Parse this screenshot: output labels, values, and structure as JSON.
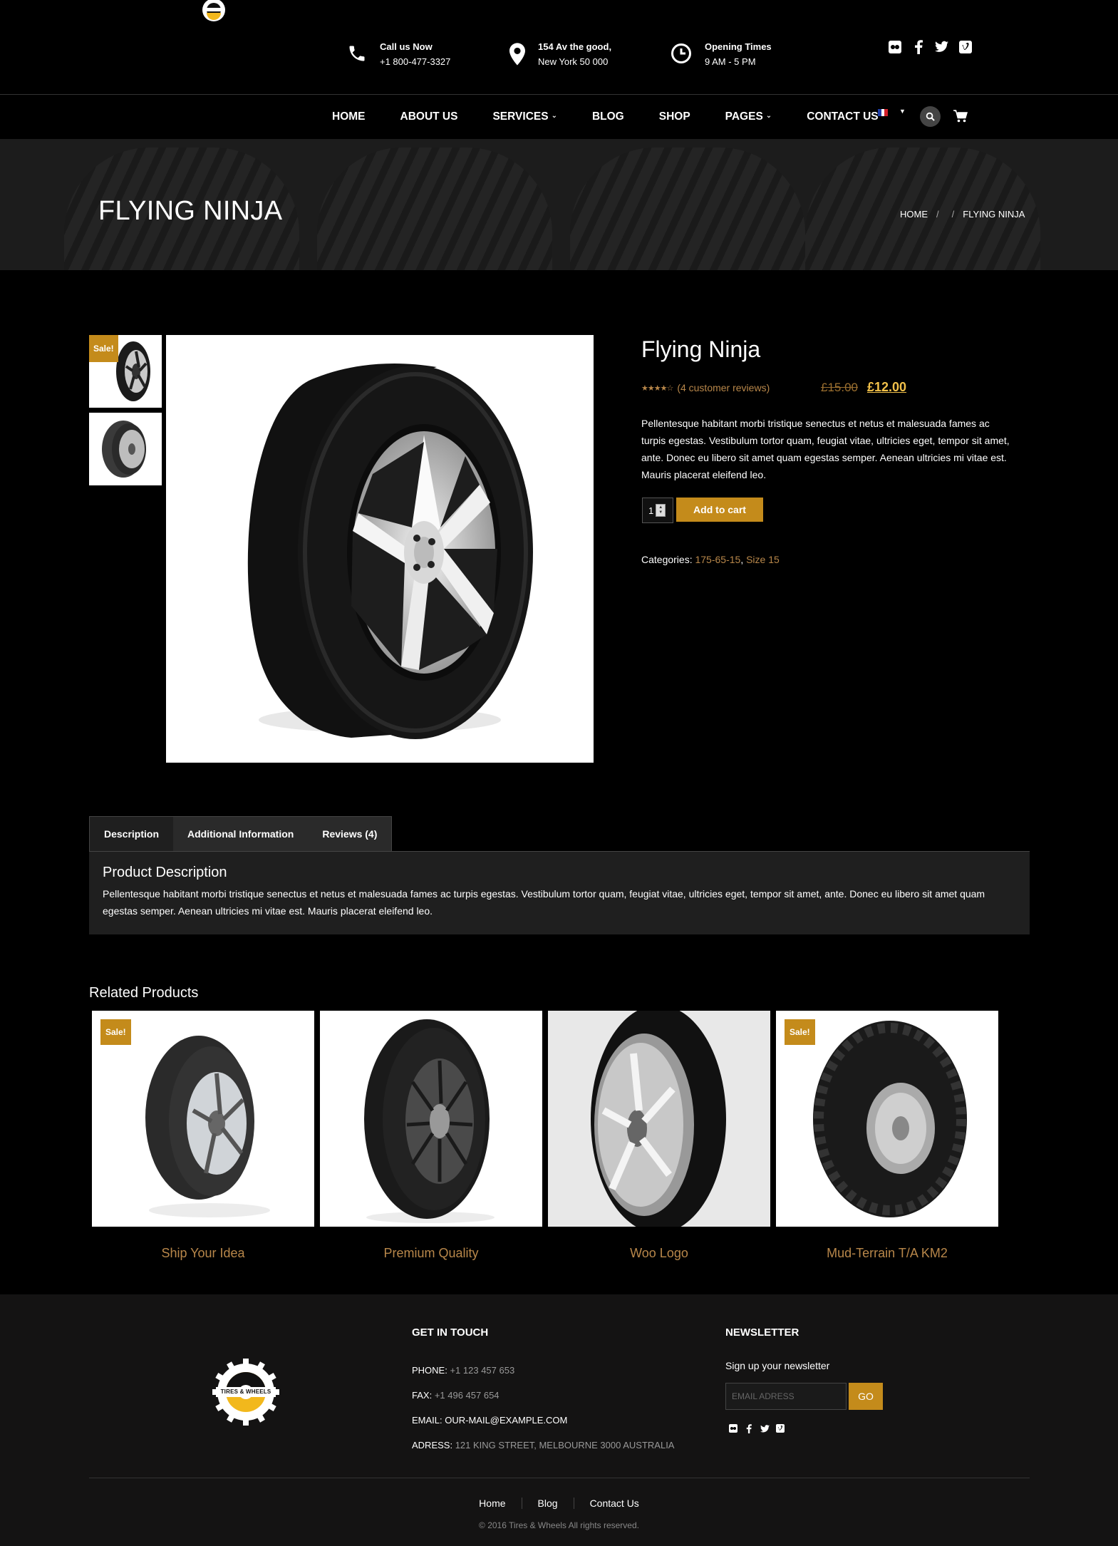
{
  "header": {
    "contacts": [
      {
        "icon": "phone-icon",
        "line1": "Call us Now",
        "line2": "+1 800-477-3327"
      },
      {
        "icon": "location-pin-icon",
        "line1": "154 Av the good,",
        "line2": "New York 50 000"
      },
      {
        "icon": "clock-icon",
        "line1": "Opening Times",
        "line2": "9 AM - 5 PM"
      }
    ],
    "social": [
      "flickr-icon",
      "facebook-icon",
      "twitter-icon",
      "vimeo-icon"
    ]
  },
  "nav": {
    "items": [
      "HOME",
      "ABOUT US",
      "SERVICES",
      "BLOG",
      "SHOP",
      "PAGES",
      "CONTACT US"
    ],
    "language": "fr-flag-icon",
    "icons": [
      "search-icon",
      "cart-icon"
    ]
  },
  "page_header": {
    "title": "FLYING NINJA",
    "breadcrumb": [
      "HOME",
      "FLYING NINJA"
    ]
  },
  "product": {
    "sale_badge": "Sale!",
    "name": "Flying Ninja",
    "rating": 4,
    "reviews_link": "(4 customer reviews)",
    "price_old": "£15.00",
    "price_new": "£12.00",
    "short_description": "Pellentesque habitant morbi tristique senectus et netus et malesuada fames ac turpis egestas. Vestibulum tortor quam, feugiat vitae, ultricies eget, tempor sit amet, ante. Donec eu libero sit amet quam egestas semper. Aenean ultricies mi vitae est. Mauris placerat eleifend leo.",
    "quantity": "1",
    "add_to_cart": "Add to cart",
    "categories_label": "Categories:",
    "categories": [
      "175-65-15",
      "Size 15"
    ]
  },
  "tabs": {
    "items": [
      "Description",
      "Additional Information",
      "Reviews (4)"
    ],
    "active": "Description",
    "panel_title": "Product Description",
    "panel_text": "Pellentesque habitant morbi tristique senectus et netus et malesuada fames ac turpis egestas. Vestibulum tortor quam, feugiat vitae, ultricies eget, tempor sit amet, ante. Donec eu libero sit amet quam egestas semper. Aenean ultricies mi vitae est. Mauris placerat eleifend leo."
  },
  "related": {
    "title": "Related Products",
    "items": [
      {
        "name": "Ship Your Idea",
        "sale": "Sale!"
      },
      {
        "name": "Premium Quality",
        "sale": ""
      },
      {
        "name": "Woo Logo",
        "sale": ""
      },
      {
        "name": "Mud-Terrain T/A KM2",
        "sale": "Sale!"
      }
    ]
  },
  "footer": {
    "logo_text": "TIRES & WHEELS",
    "get_in_touch": {
      "title": "GET IN TOUCH",
      "phone_label": "PHONE:",
      "phone": "+1 123 457 653",
      "fax_label": "FAX:",
      "fax": "+1 496 457 654",
      "email_label": "EMAIL:",
      "email": "OUR-MAIL@EXAMPLE.COM",
      "address_label": "ADRESS:",
      "address": "121 KING STREET, MELBOURNE 3000 AUSTRALIA"
    },
    "newsletter": {
      "title": "NEWSLETTER",
      "label": "Sign up your newsletter",
      "placeholder": "EMAIL ADRESS",
      "button": "GO"
    },
    "social": [
      "flickr-icon",
      "facebook-icon",
      "twitter-icon",
      "vimeo-icon"
    ],
    "links": [
      "Home",
      "Blog",
      "Contact Us"
    ],
    "copyright": "© 2016 Tires & Wheels All rights reserved."
  },
  "colors": {
    "accent": "#c48b1b",
    "link": "#b8874a",
    "background": "#000000",
    "footer_bg": "#141313"
  }
}
